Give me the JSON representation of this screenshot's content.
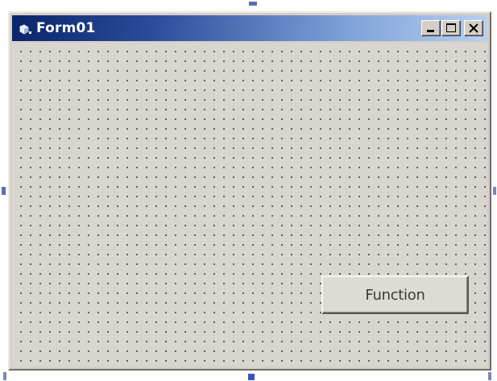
{
  "window": {
    "title": "Form01",
    "icon": "form-icon",
    "title_gradient_start": "#0a246a",
    "title_gradient_end": "#b8cff0",
    "background": "#d4d0c8"
  },
  "caption_buttons": {
    "minimize_icon": "minimize-icon",
    "maximize_icon": "maximize-icon",
    "close_icon": "close-icon"
  },
  "form": {
    "grid": "dotted",
    "button_label": "Function"
  }
}
